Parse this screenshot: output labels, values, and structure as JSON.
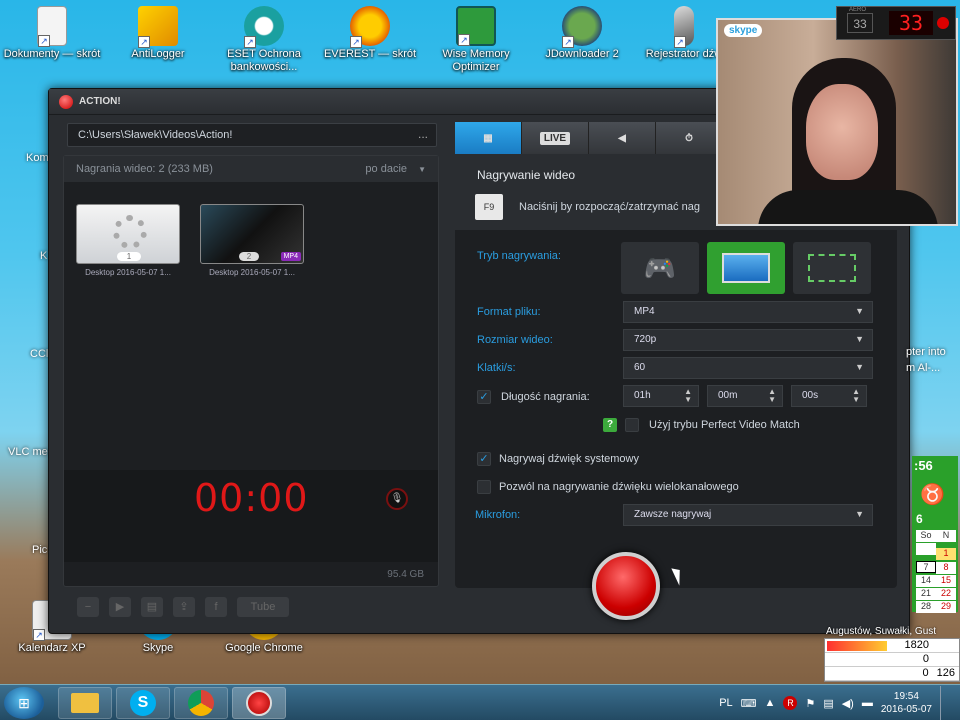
{
  "desktop_icons": [
    {
      "label": "Dokumenty — skrót"
    },
    {
      "label": "AntiLogger"
    },
    {
      "label": "ESET Ochrona bankowości..."
    },
    {
      "label": "EVEREST — skrót"
    },
    {
      "label": "Wise Memory Optimizer"
    },
    {
      "label": "JDownloader 2"
    },
    {
      "label": "Rejestrator dźw"
    },
    {
      "label": "Kalendarz XP"
    },
    {
      "label": "Skype"
    },
    {
      "label": "Google Chrome"
    }
  ],
  "left_partial_labels": [
    "Kom",
    "K",
    "CCl",
    "VLC me",
    "Pic"
  ],
  "action": {
    "title": "ACTION!",
    "path": "C:\\Users\\Sławek\\Videos\\Action!",
    "path_more": "...",
    "recordings_label": "Nagrania wideo: 2 (233 MB)",
    "sort_label": "po dacie",
    "thumbs": [
      {
        "num": "1",
        "caption": "Desktop 2016-05-07 1..."
      },
      {
        "num": "2",
        "caption": "Desktop 2016-05-07 1...",
        "badge": "MP4"
      }
    ],
    "timer": "00:00",
    "disk": "95.4 GB",
    "tabs": [
      {
        "label": "",
        "icon": "film-icon"
      },
      {
        "label": "LIVE"
      },
      {
        "label": "",
        "icon": "speaker-icon"
      },
      {
        "label": "",
        "icon": "stopwatch-icon"
      }
    ],
    "section_title": "Nagrywanie wideo",
    "hotkey": "F9",
    "hint": "Naciśnij by rozpocząć/zatrzymać nag",
    "mode_label": "Tryb nagrywania:",
    "format_label": "Format pliku:",
    "format_value": "MP4",
    "size_label": "Rozmiar wideo:",
    "size_value": "720p",
    "fps_label": "Klatki/s:",
    "fps_value": "60",
    "duration_label": "Długość nagrania:",
    "duration_h": "01h",
    "duration_m": "00m",
    "duration_s": "00s",
    "perfect_match": "Użyj trybu Perfect Video Match",
    "help": "?",
    "system_audio": "Nagrywaj dźwięk systemowy",
    "multichannel": "Pozwól na nagrywanie dźwięku wielokanałowego",
    "mic_label": "Mikrofon:",
    "mic_value": "Zawsze nagrywaj",
    "youtube": "Tube"
  },
  "skype": {
    "label": "skype"
  },
  "counter": {
    "left": "33",
    "right": "33",
    "top_label": "AERO"
  },
  "gadgets": {
    "partial_text_1": "pter into",
    "partial_text_2": "m Al-...",
    "time": ":56",
    "month_num": "6",
    "cal_head": [
      "So",
      "N"
    ],
    "cal_rows": [
      [
        "",
        "1"
      ],
      [
        "7",
        "8"
      ],
      [
        "14",
        "15"
      ],
      [
        "21",
        "22"
      ],
      [
        "28",
        "29"
      ]
    ],
    "stats": [
      "1820",
      "0",
      "0",
      "126"
    ],
    "location": "Augustów, Suwałki, Gust"
  },
  "taskbar": {
    "lang": "PL",
    "time": "19:54",
    "date": "2016-05-07"
  }
}
